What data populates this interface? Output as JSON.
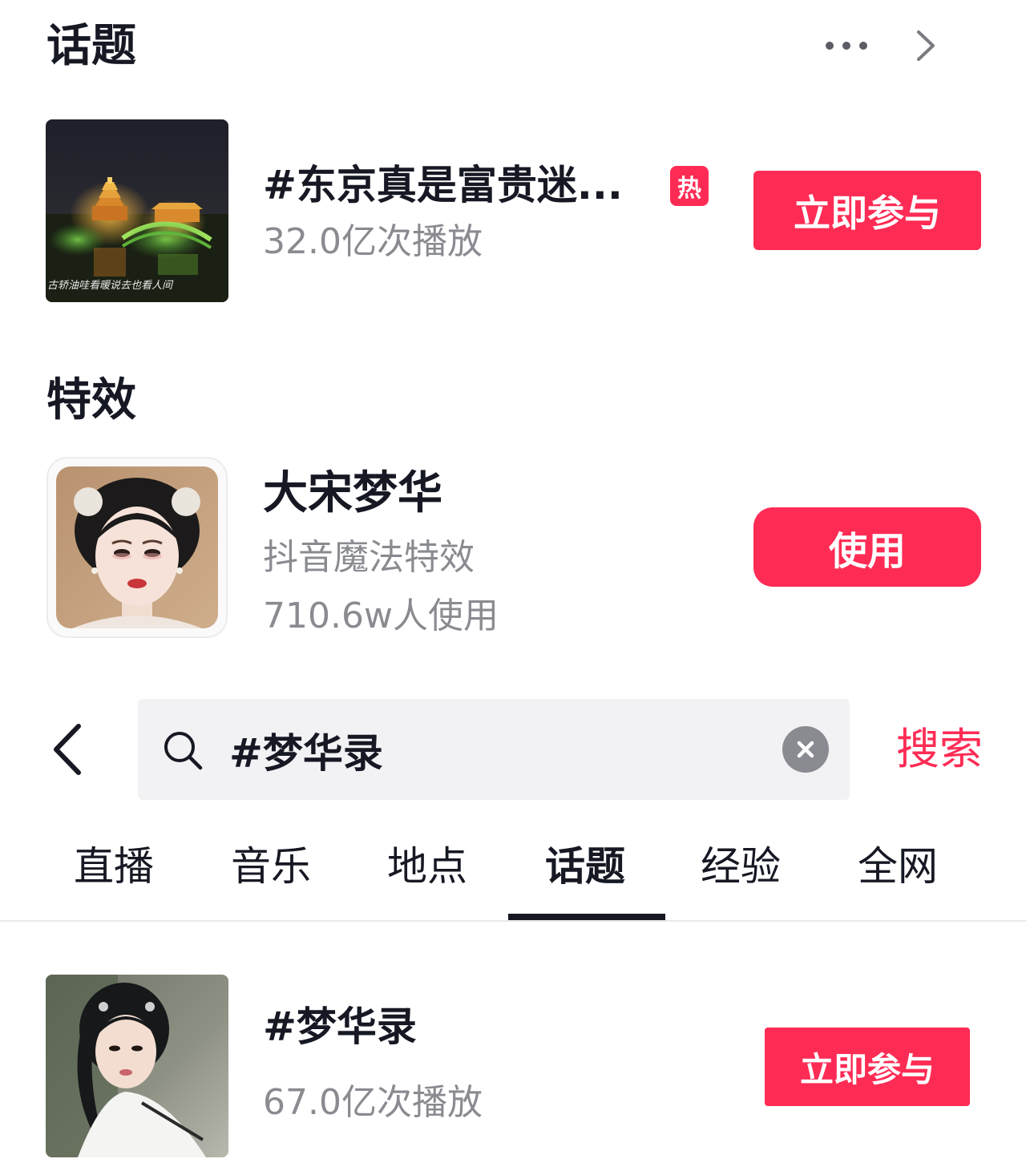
{
  "topics_section": {
    "title": "话题",
    "more_icon": "more-dots-icon",
    "chevron_icon": "chevron-right-icon",
    "item": {
      "name": "#东京真是富贵迷...",
      "hot_badge": "热",
      "plays": "32.0亿次播放",
      "join_label": "立即参与",
      "thumbnail_caption": "古轿油哇看暖说去也看人间"
    }
  },
  "effects_section": {
    "title": "特效",
    "item": {
      "name": "大宋梦华",
      "subtitle": "抖音魔法特效",
      "users": "710.6w人使用",
      "use_label": "使用"
    }
  },
  "search_bar": {
    "back_icon": "back-arrow-icon",
    "search_icon": "search-icon",
    "query": "#梦华录",
    "clear_icon": "clear-icon",
    "action_label": "搜索"
  },
  "tabs": [
    {
      "label": "直播",
      "active": false
    },
    {
      "label": "音乐",
      "active": false
    },
    {
      "label": "地点",
      "active": false
    },
    {
      "label": "话题",
      "active": true
    },
    {
      "label": "经验",
      "active": false
    },
    {
      "label": "全网",
      "active": false
    }
  ],
  "result_item": {
    "name": "#梦华录",
    "plays": "67.0亿次播放",
    "join_label": "立即参与"
  },
  "colors": {
    "accent": "#fe2c55",
    "text_primary": "#161823",
    "text_secondary": "#8a8b91",
    "search_bg": "#f2f2f4"
  }
}
